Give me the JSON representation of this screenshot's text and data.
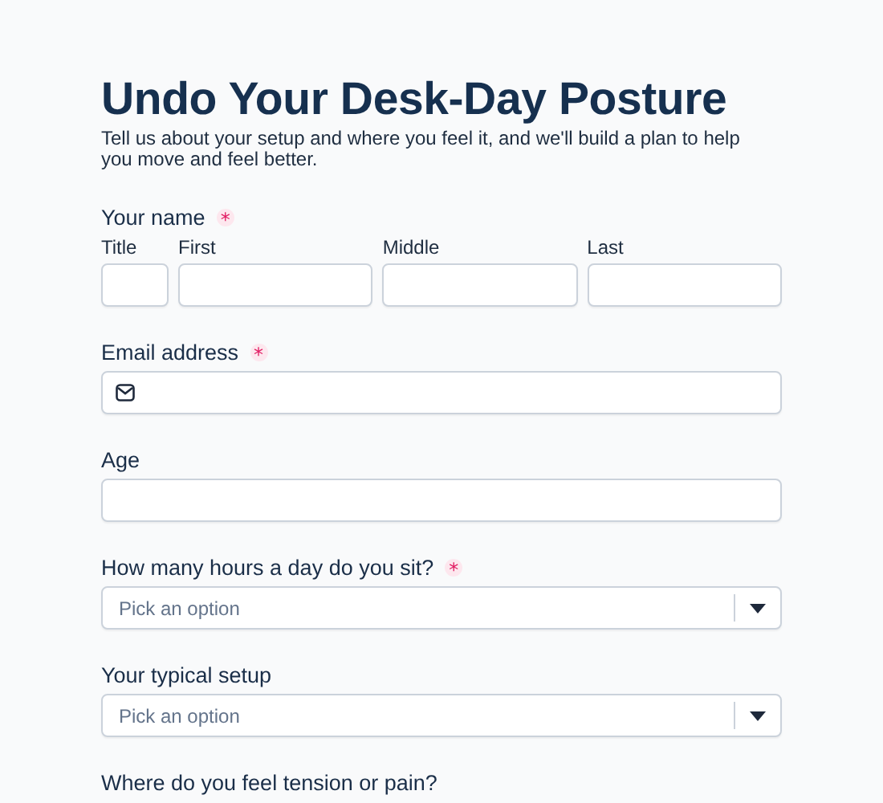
{
  "title": "Undo Your Desk-Day Posture",
  "subtitle": "Tell us about your setup and where you feel it, and we'll build a plan to help you move and feel better.",
  "fields": [
    {
      "kind": "name",
      "label": "Your name",
      "required_mark": "*",
      "parts": [
        {
          "label": "Title"
        },
        {
          "label": "First"
        },
        {
          "label": "Middle"
        },
        {
          "label": "Last"
        }
      ]
    },
    {
      "kind": "email",
      "label": "Email address",
      "required_mark": "*"
    },
    {
      "kind": "text",
      "label": "Age"
    },
    {
      "kind": "select",
      "label": "How many hours a day do you sit?",
      "required_mark": "*",
      "placeholder": "Pick an option"
    },
    {
      "kind": "select",
      "label": "Your typical setup",
      "placeholder": "Pick an option"
    },
    {
      "kind": "label",
      "label": "Where do you feel tension or pain?"
    }
  ]
}
